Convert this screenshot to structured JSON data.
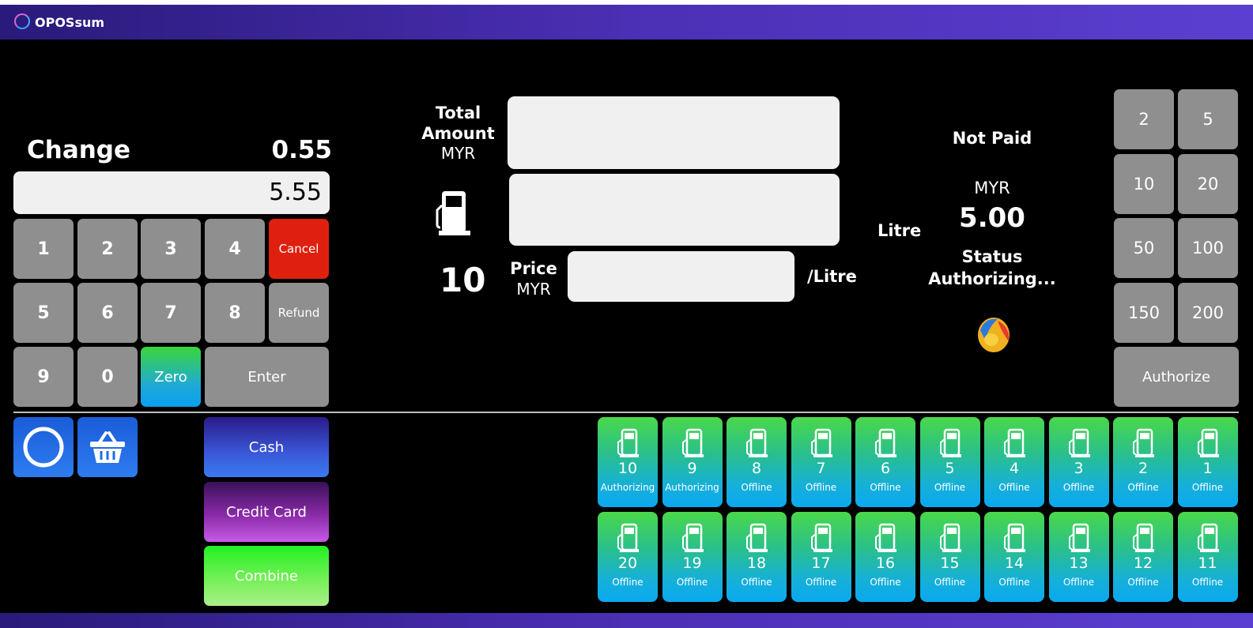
{
  "app": {
    "title": "OPOSsum"
  },
  "change": {
    "label": "Change",
    "value": "0.55",
    "tendered": "5.55"
  },
  "keypad": {
    "keys": [
      "1",
      "2",
      "3",
      "4",
      "5",
      "6",
      "7",
      "8",
      "9",
      "0"
    ],
    "cancel": "Cancel",
    "refund": "Refund",
    "zero": "Zero",
    "enter": "Enter"
  },
  "transaction": {
    "total_label_line1": "Total",
    "total_label_line2": "Amount",
    "total_currency": "MYR",
    "nozzle": "10",
    "price_label": "Price",
    "price_currency": "MYR",
    "per_litre": "/Litre",
    "litre_label": "Litre"
  },
  "status_panel": {
    "payment": "Not Paid",
    "currency": "MYR",
    "amount": "5.00",
    "status_label": "Status",
    "status_value": "Authorizing..."
  },
  "quick_amounts": [
    "2",
    "5",
    "10",
    "20",
    "50",
    "100",
    "150",
    "200"
  ],
  "authorize_label": "Authorize",
  "payment_buttons": {
    "cash": "Cash",
    "credit": "Credit Card",
    "combine": "Combine"
  },
  "pumps_row1": [
    {
      "num": "10",
      "status": "Authorizing"
    },
    {
      "num": "9",
      "status": "Authorizing"
    },
    {
      "num": "8",
      "status": "Offline"
    },
    {
      "num": "7",
      "status": "Offline"
    },
    {
      "num": "6",
      "status": "Offline"
    },
    {
      "num": "5",
      "status": "Offline"
    },
    {
      "num": "4",
      "status": "Offline"
    },
    {
      "num": "3",
      "status": "Offline"
    },
    {
      "num": "2",
      "status": "Offline"
    },
    {
      "num": "1",
      "status": "Offline"
    }
  ],
  "pumps_row2": [
    {
      "num": "20",
      "status": "Offline"
    },
    {
      "num": "19",
      "status": "Offline"
    },
    {
      "num": "18",
      "status": "Offline"
    },
    {
      "num": "17",
      "status": "Offline"
    },
    {
      "num": "16",
      "status": "Offline"
    },
    {
      "num": "15",
      "status": "Offline"
    },
    {
      "num": "14",
      "status": "Offline"
    },
    {
      "num": "13",
      "status": "Offline"
    },
    {
      "num": "12",
      "status": "Offline"
    },
    {
      "num": "11",
      "status": "Offline"
    }
  ],
  "colors": {
    "cancel": "#e0200e",
    "key": "#8f8f8f",
    "titlebar": "#4b2fb4",
    "pump_top": "#4ad84a",
    "pump_bottom": "#0aa8f0"
  }
}
